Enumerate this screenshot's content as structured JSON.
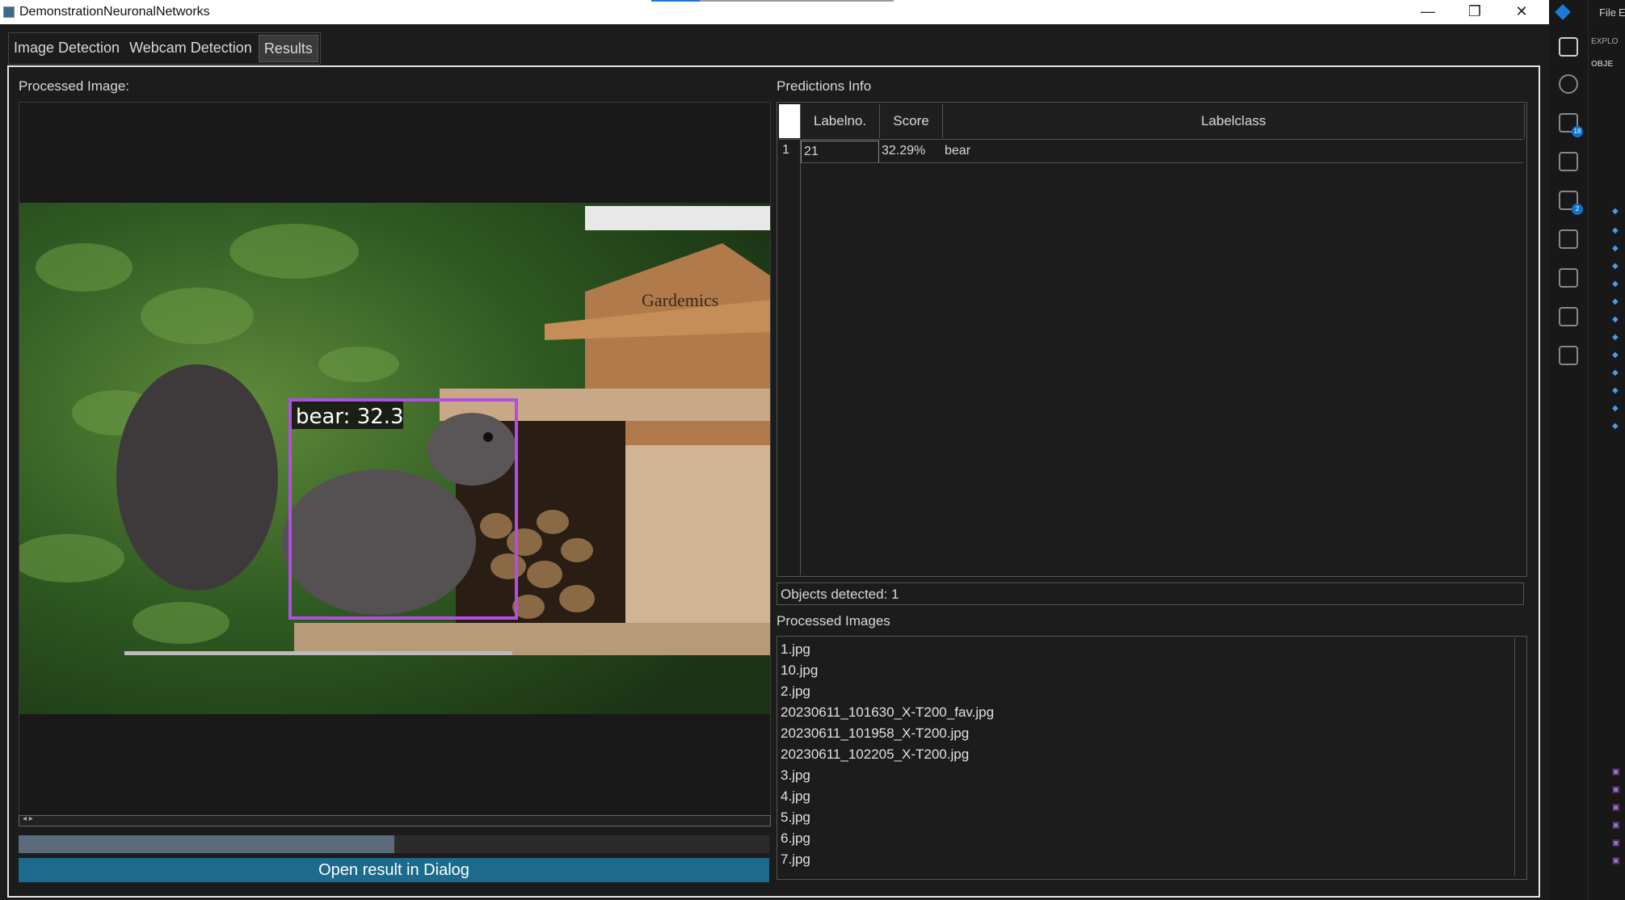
{
  "window": {
    "title": "DemonstrationNeuronalNetworks",
    "minimize": "—",
    "restore": "❐",
    "close": "✕"
  },
  "tabs": [
    {
      "label": "Image Detection"
    },
    {
      "label": "Webcam Detection"
    },
    {
      "label": "Results"
    }
  ],
  "left_panel": {
    "processed_image_label": "Processed Image:",
    "detection_label": "bear: 32.3",
    "progress_fraction": 0.5,
    "open_button": "Open result in Dialog",
    "scroll_arrows": "◂ ▸"
  },
  "predictions": {
    "section_label": "Predictions Info",
    "columns": [
      "Labelno.",
      "Score",
      "Labelclass"
    ],
    "rows": [
      {
        "index": "1",
        "labelno": "21",
        "score": "32.29%",
        "labelclass": "bear"
      }
    ],
    "objects_detected": "Objects detected: 1"
  },
  "processed_images": {
    "section_label": "Processed Images",
    "files": [
      "1.jpg",
      "10.jpg",
      "2.jpg",
      "20230611_101630_X-T200_fav.jpg",
      "20230611_101958_X-T200.jpg",
      "20230611_102205_X-T200.jpg",
      "3.jpg",
      "4.jpg",
      "5.jpg",
      "6.jpg",
      "7.jpg"
    ]
  },
  "vscode": {
    "menu_file": "File",
    "menu_edit": "Ed",
    "explorer_label": "EXPLO",
    "project_label": "OBJE",
    "badge_source_control": "18",
    "badge_extensions": "2"
  },
  "colors": {
    "accent_button": "#1c6a8c",
    "detection_box": "#b04fe0",
    "vscode_blue": "#0e73cc"
  }
}
